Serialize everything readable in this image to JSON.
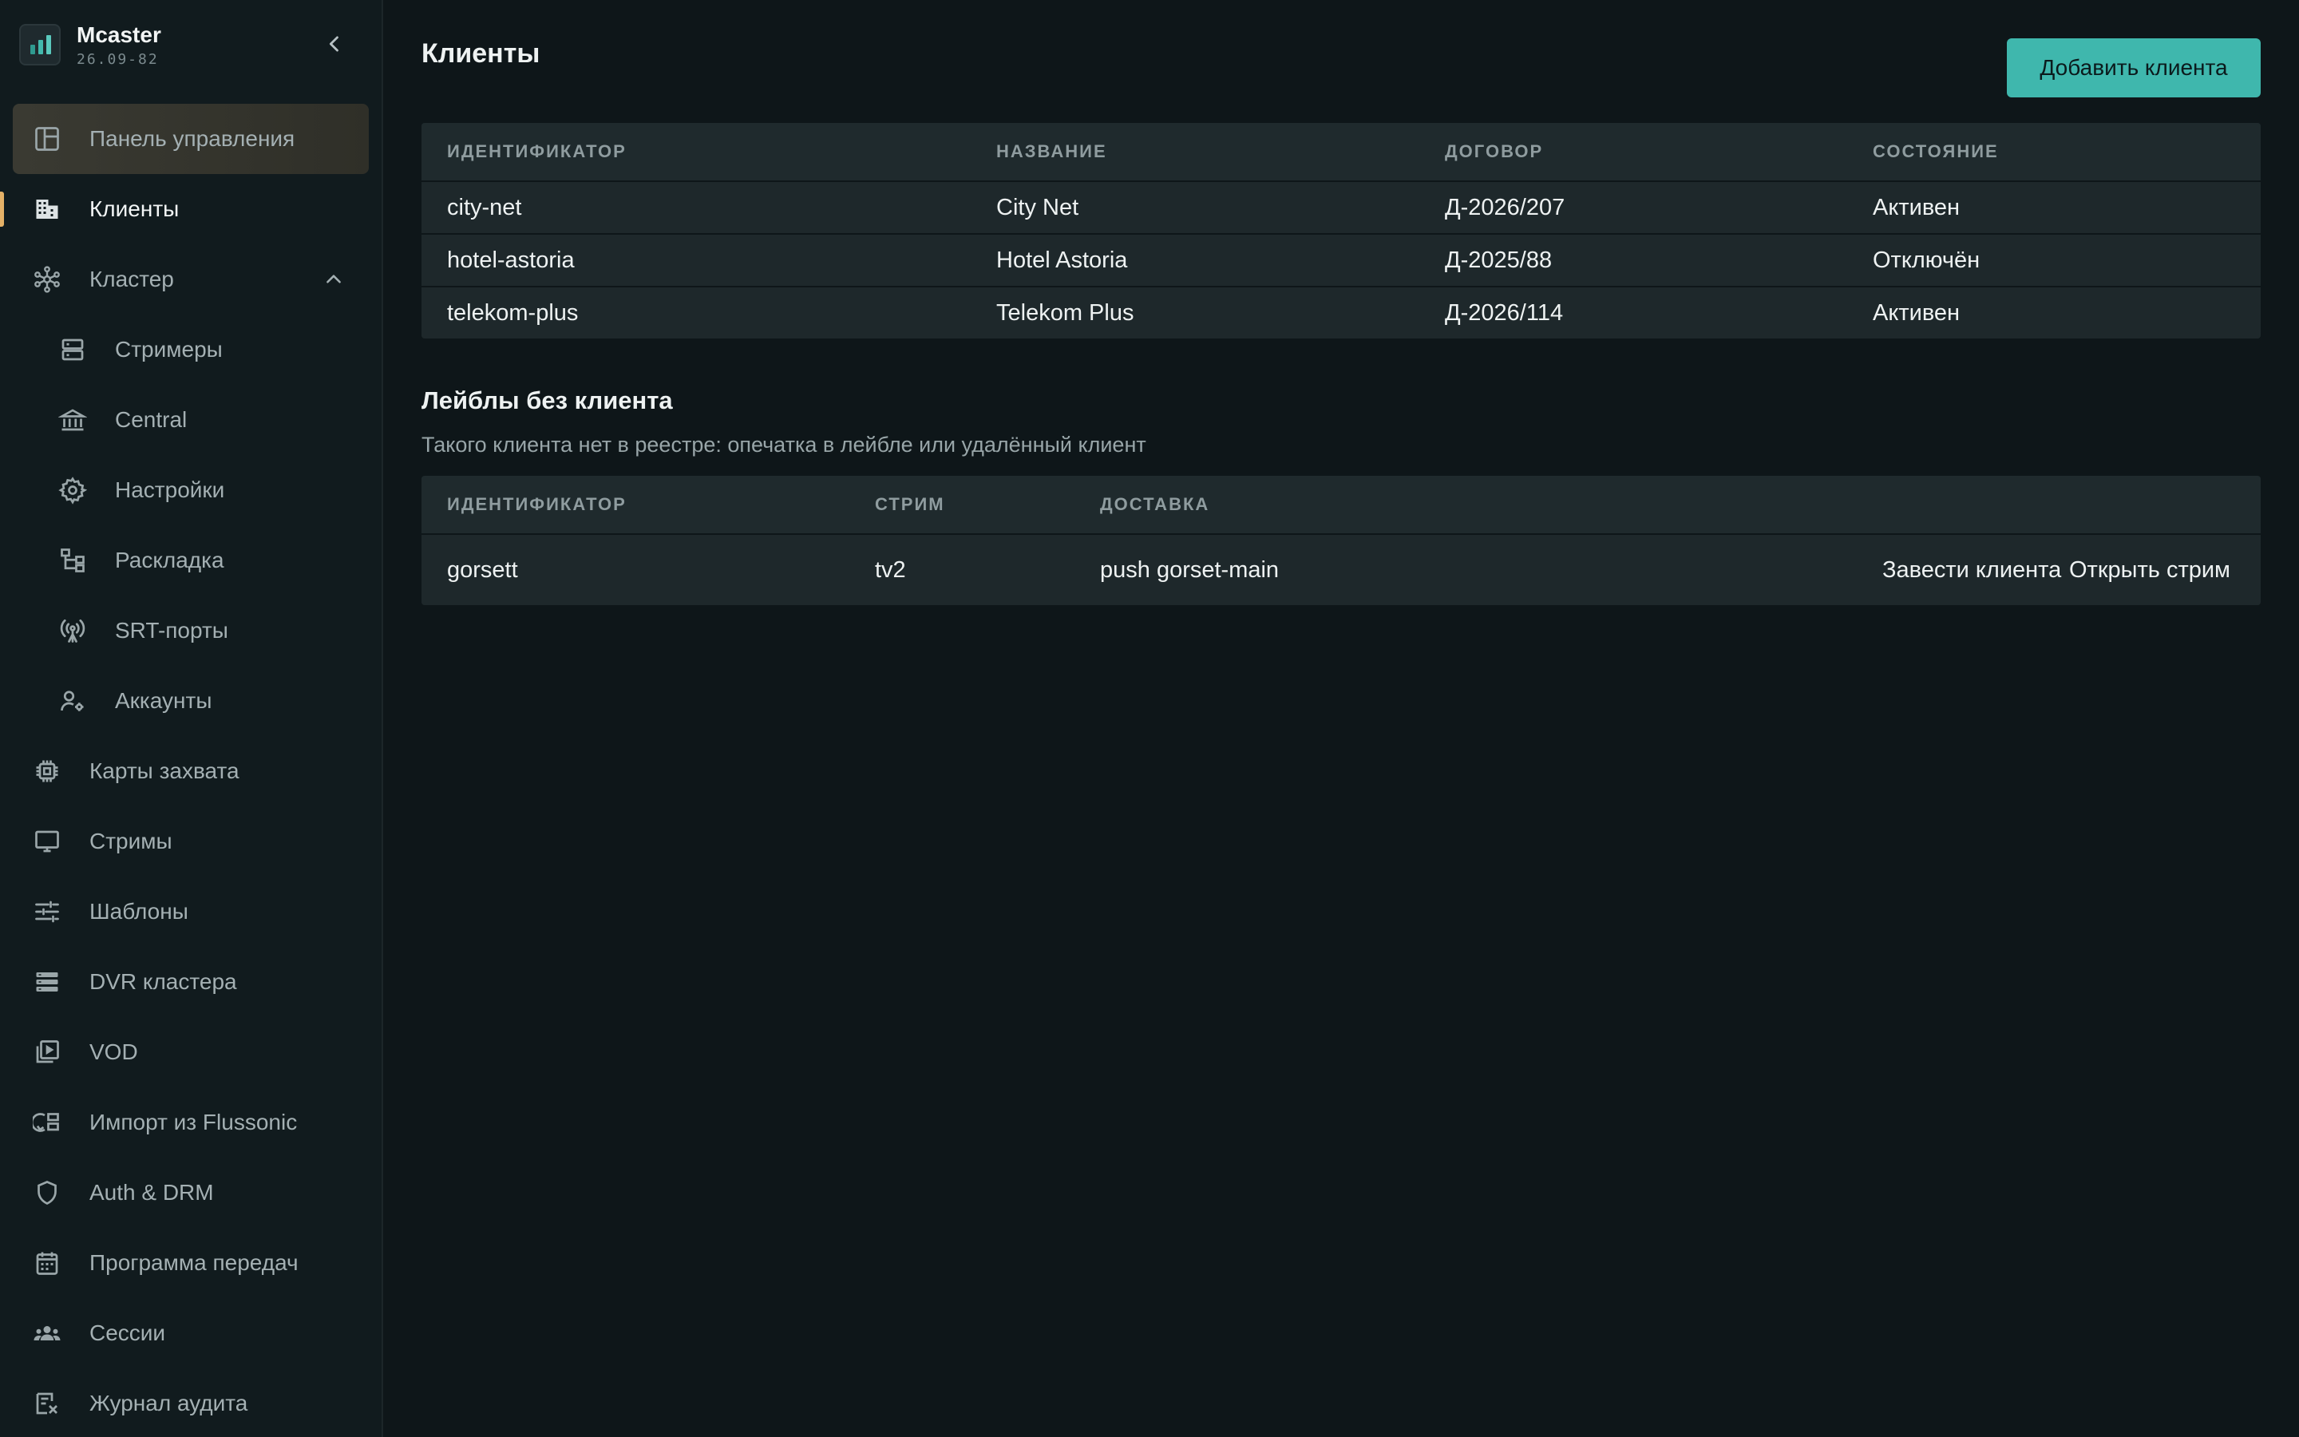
{
  "brand": {
    "name": "Mcaster",
    "version": "26.09-82",
    "colors": {
      "bar1": "#2f9a8f",
      "bar2": "#43b9ad",
      "bar3": "#5ac9bd"
    }
  },
  "sidebar": {
    "collapse_icon": "chevron-left-icon",
    "items": [
      {
        "label": "Панель управления",
        "icon": "dashboard-icon",
        "level": 1,
        "state": "highlight"
      },
      {
        "label": "Клиенты",
        "icon": "building-icon",
        "level": 1,
        "state": "active"
      },
      {
        "label": "Кластер",
        "icon": "cluster-icon",
        "level": 1,
        "expanded": true
      },
      {
        "label": "Стримеры",
        "icon": "server-icon",
        "level": 2
      },
      {
        "label": "Central",
        "icon": "bank-icon",
        "level": 2
      },
      {
        "label": "Настройки",
        "icon": "gear-icon",
        "level": 2
      },
      {
        "label": "Раскладка",
        "icon": "hierarchy-icon",
        "level": 2
      },
      {
        "label": "SRT-порты",
        "icon": "antenna-icon",
        "level": 2
      },
      {
        "label": "Аккаунты",
        "icon": "user-gear-icon",
        "level": 2
      },
      {
        "label": "Карты захвата",
        "icon": "chip-icon",
        "level": 1
      },
      {
        "label": "Стримы",
        "icon": "monitor-icon",
        "level": 1
      },
      {
        "label": "Шаблоны",
        "icon": "sliders-icon",
        "level": 1
      },
      {
        "label": "DVR кластера",
        "icon": "storage-icon",
        "level": 1
      },
      {
        "label": "VOD",
        "icon": "video-library-icon",
        "level": 1
      },
      {
        "label": "Импорт из Flussonic",
        "icon": "import-icon",
        "level": 1
      },
      {
        "label": "Auth & DRM",
        "icon": "shield-icon",
        "level": 1
      },
      {
        "label": "Программа передач",
        "icon": "calendar-icon",
        "level": 1
      },
      {
        "label": "Сессии",
        "icon": "users-icon",
        "level": 1
      },
      {
        "label": "Журнал аудита",
        "icon": "audit-icon",
        "level": 1
      }
    ]
  },
  "header": {
    "title": "Клиенты",
    "add_button": "Добавить клиента"
  },
  "clients_table": {
    "columns": [
      "ИДЕНТИФИКАТОР",
      "НАЗВАНИЕ",
      "ДОГОВОР",
      "СОСТОЯНИЕ"
    ],
    "rows": [
      [
        "city-net",
        "City Net",
        "Д-2026/207",
        "Активен"
      ],
      [
        "hotel-astoria",
        "Hotel Astoria",
        "Д-2025/88",
        "Отключён"
      ],
      [
        "telekom-plus",
        "Telekom Plus",
        "Д-2026/114",
        "Активен"
      ]
    ]
  },
  "orphans": {
    "title": "Лейблы без клиента",
    "subtitle": "Такого клиента нет в реестре: опечатка в лейбле или удалённый клиент",
    "columns": [
      "ИДЕНТИФИКАТОР",
      "СТРИМ",
      "ДОСТАВКА"
    ],
    "rows": [
      {
        "id": "gorsett",
        "stream": "tv2",
        "delivery": "push gorset-main",
        "action_create": "Завести клиента",
        "action_open": "Открыть стрим"
      }
    ]
  },
  "colors": {
    "accent": "#3fb7ad",
    "link": "#46bdb1",
    "active_marker": "#e5b167",
    "background": "#0e1619",
    "sidebar": "#111b1e"
  }
}
